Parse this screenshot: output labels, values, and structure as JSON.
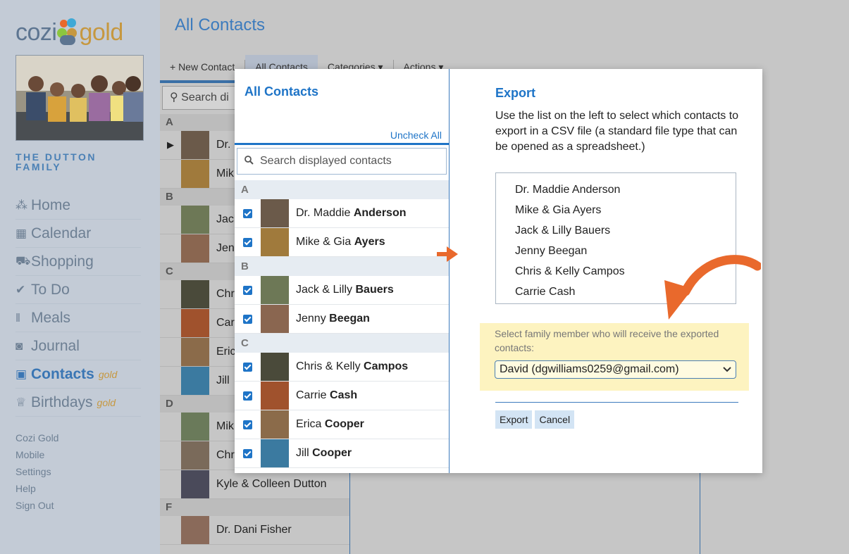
{
  "app": {
    "logo_left": "cozi",
    "logo_right": "gold",
    "family_name": "THE DUTTON FAMILY"
  },
  "sidebar": {
    "nav": [
      {
        "label": "Home",
        "icon": "home-icon",
        "glyph": "⁂"
      },
      {
        "label": "Calendar",
        "icon": "calendar-icon",
        "glyph": "▦"
      },
      {
        "label": "Shopping",
        "icon": "cart-icon",
        "glyph": "⛟"
      },
      {
        "label": "To Do",
        "icon": "check-icon",
        "glyph": "✔"
      },
      {
        "label": "Meals",
        "icon": "fork-knife-icon",
        "glyph": "ǁ"
      },
      {
        "label": "Journal",
        "icon": "camera-icon",
        "glyph": "◙"
      },
      {
        "label": "Contacts",
        "icon": "address-book-icon",
        "glyph": "▣",
        "active": true,
        "tag": "gold"
      },
      {
        "label": "Birthdays",
        "icon": "gift-icon",
        "glyph": "♕",
        "tag": "gold"
      }
    ],
    "links": [
      "Cozi Gold",
      "Mobile",
      "Settings",
      "Help",
      "Sign Out"
    ]
  },
  "background": {
    "page_title": "All Contacts",
    "toolbar": {
      "new_contact": "+ New Contact",
      "all_contacts": "All Contacts",
      "categories": "Categories ▾",
      "actions": "Actions ▾"
    },
    "search_placeholder": "Search di",
    "list": [
      {
        "header": "A"
      },
      {
        "text": "Dr.",
        "marker": "▶",
        "color": "#6b5a4a"
      },
      {
        "text": "Mik",
        "color": "#a07a3c"
      },
      {
        "header": "B"
      },
      {
        "text": "Jack",
        "color": "#6d7856"
      },
      {
        "text": "Jenn",
        "color": "#8a6650"
      },
      {
        "header": "C"
      },
      {
        "text": "Chr",
        "color": "#4a4a3a"
      },
      {
        "text": "Car",
        "color": "#a0522d"
      },
      {
        "text": "Eric",
        "color": "#8b6b4a"
      },
      {
        "text": "Jill",
        "color": "#3b7aa0"
      },
      {
        "header": "D"
      },
      {
        "text": "Mik",
        "color": "#6a7a5a"
      },
      {
        "text": "Chris Dutton",
        "color": "#7a6a5a"
      },
      {
        "text": "Kyle & Colleen Dutton",
        "color": "#4a4a5a"
      },
      {
        "header": "F"
      },
      {
        "text": "Dr. Dani Fisher",
        "color": "#8a6a5a"
      }
    ]
  },
  "modal": {
    "left": {
      "title": "All Contacts",
      "uncheck_all": "Uncheck All",
      "search_placeholder": "Search displayed contacts",
      "sections": [
        {
          "letter": "A",
          "contacts": [
            {
              "first": "Dr. Maddie",
              "last": "Anderson",
              "color": "#6b5a4a"
            },
            {
              "first": "Mike & Gia",
              "last": "Ayers",
              "color": "#a07a3c"
            }
          ]
        },
        {
          "letter": "B",
          "contacts": [
            {
              "first": "Jack & Lilly",
              "last": "Bauers",
              "color": "#6d7856"
            },
            {
              "first": "Jenny",
              "last": "Beegan",
              "color": "#8a6650"
            }
          ]
        },
        {
          "letter": "C",
          "contacts": [
            {
              "first": "Chris & Kelly",
              "last": "Campos",
              "color": "#4a4a3a"
            },
            {
              "first": "Carrie",
              "last": "Cash",
              "color": "#a0522d"
            },
            {
              "first": "Erica",
              "last": "Cooper",
              "color": "#8b6b4a"
            },
            {
              "first": "Jill",
              "last": "Cooper",
              "color": "#3b7aa0"
            }
          ]
        }
      ]
    },
    "right": {
      "title": "Export",
      "description": "Use the list on the left to select which contacts to export in a CSV file (a standard file type that can be opened as a spreadsheet.)",
      "export_list": [
        "Dr. Maddie Anderson",
        "Mike & Gia Ayers",
        "Jack & Lilly Bauers",
        "Jenny Beegan",
        "Chris & Kelly Campos",
        "Carrie Cash"
      ],
      "recipient_label": "Select family member who will receive the exported contacts:",
      "recipient_value": "David (dgwilliams0259@gmail.com)",
      "export_button": "Export",
      "cancel_button": "Cancel"
    }
  },
  "colors": {
    "accent": "#1e74c7",
    "highlight": "#fdf3c0",
    "arrow": "#e9692c"
  }
}
